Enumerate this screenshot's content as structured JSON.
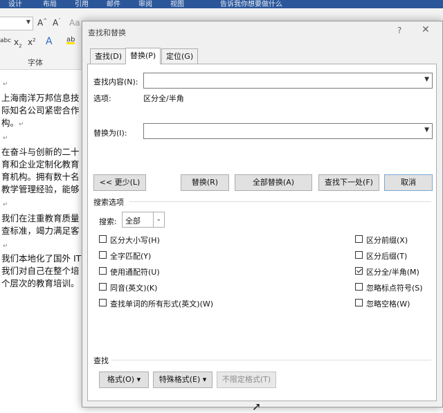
{
  "word": {
    "ribbon_tabs": [
      "设计",
      "布局",
      "引用",
      "邮件",
      "审阅",
      "视图",
      "告诉我你想要做什么"
    ],
    "font_group_label": "字体",
    "doc_lines": [
      "上海南洋万邦信息技",
      "际知名公司紧密合作",
      "构。",
      "在奋斗与创新的二十",
      "育和企业定制化教育",
      "育机构。拥有数十名",
      "教学管理经验，能够",
      "我们在注重教育质量",
      "查标准，竭力满足客",
      "我们本地化了国外 IT",
      "我们对自己在整个培",
      "个层次的教育培训。"
    ],
    "para_mark": "↵"
  },
  "dialog": {
    "title": "查找和替换",
    "help": "?",
    "close": "✕",
    "tabs": [
      "查找(D)",
      "替换(P)",
      "定位(G)"
    ],
    "active_tab": "替换(P)",
    "find_label": "查找内容(N):",
    "find_value": "",
    "options_label": "选项:",
    "options_value": "区分全/半角",
    "replace_label": "替换为(I):",
    "replace_value": "",
    "buttons": {
      "less": "<< 更少(L)",
      "replace": "替换(R)",
      "replace_all": "全部替换(A)",
      "find_next": "查找下一处(F)",
      "cancel": "取消"
    },
    "search_options_title": "搜索选项",
    "search_label": "搜索:",
    "search_value": "全部",
    "left_checks": [
      {
        "label": "区分大小写(H)",
        "checked": false
      },
      {
        "label": "全字匹配(Y)",
        "checked": false
      },
      {
        "label": "使用通配符(U)",
        "checked": false
      },
      {
        "label": "同音(英文)(K)",
        "checked": false
      },
      {
        "label": "查找单词的所有形式(英文)(W)",
        "checked": false
      }
    ],
    "right_checks": [
      {
        "label": "区分前缀(X)",
        "checked": false
      },
      {
        "label": "区分后缀(T)",
        "checked": false
      },
      {
        "label": "区分全/半角(M)",
        "checked": true
      },
      {
        "label": "忽略标点符号(S)",
        "checked": false
      },
      {
        "label": "忽略空格(W)",
        "checked": false
      }
    ],
    "find_section_title": "查找",
    "bottom_buttons": {
      "format": "格式(O) ▾",
      "special": "特殊格式(E) ▾",
      "no_format": "不限定格式(T)"
    }
  }
}
